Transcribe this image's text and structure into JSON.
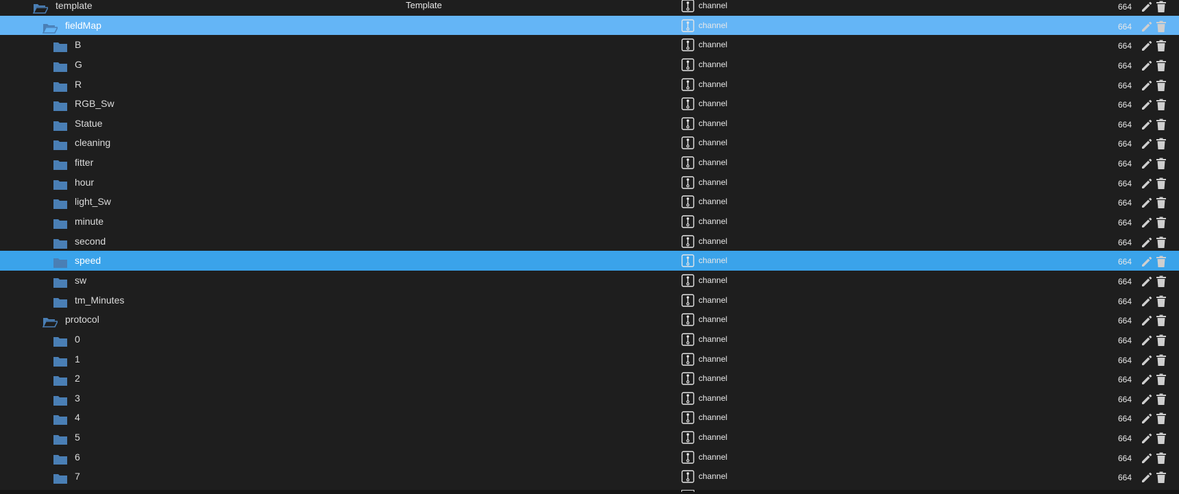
{
  "colors": {
    "background": "#1e1e1e",
    "selected_light": "#64b5f6",
    "selected_strong": "#3aa3ea",
    "folder_icon": "#4a7fb5",
    "text": "#dcdcdc"
  },
  "rows": [
    {
      "name": "template",
      "description": "Template",
      "type": "channel",
      "permission": "664",
      "level": 0,
      "open": true,
      "state": "normal"
    },
    {
      "name": "fieldMap",
      "description": "",
      "type": "channel",
      "permission": "664",
      "level": 1,
      "open": true,
      "state": "selected-light"
    },
    {
      "name": "B",
      "description": "",
      "type": "channel",
      "permission": "664",
      "level": 2,
      "open": false,
      "state": "normal"
    },
    {
      "name": "G",
      "description": "",
      "type": "channel",
      "permission": "664",
      "level": 2,
      "open": false,
      "state": "normal"
    },
    {
      "name": "R",
      "description": "",
      "type": "channel",
      "permission": "664",
      "level": 2,
      "open": false,
      "state": "normal"
    },
    {
      "name": "RGB_Sw",
      "description": "",
      "type": "channel",
      "permission": "664",
      "level": 2,
      "open": false,
      "state": "normal"
    },
    {
      "name": "Statue",
      "description": "",
      "type": "channel",
      "permission": "664",
      "level": 2,
      "open": false,
      "state": "normal"
    },
    {
      "name": "cleaning",
      "description": "",
      "type": "channel",
      "permission": "664",
      "level": 2,
      "open": false,
      "state": "normal"
    },
    {
      "name": "fitter",
      "description": "",
      "type": "channel",
      "permission": "664",
      "level": 2,
      "open": false,
      "state": "normal"
    },
    {
      "name": "hour",
      "description": "",
      "type": "channel",
      "permission": "664",
      "level": 2,
      "open": false,
      "state": "normal"
    },
    {
      "name": "light_Sw",
      "description": "",
      "type": "channel",
      "permission": "664",
      "level": 2,
      "open": false,
      "state": "normal"
    },
    {
      "name": "minute",
      "description": "",
      "type": "channel",
      "permission": "664",
      "level": 2,
      "open": false,
      "state": "normal"
    },
    {
      "name": "second",
      "description": "",
      "type": "channel",
      "permission": "664",
      "level": 2,
      "open": false,
      "state": "normal"
    },
    {
      "name": "speed",
      "description": "",
      "type": "channel",
      "permission": "664",
      "level": 2,
      "open": false,
      "state": "selected-strong"
    },
    {
      "name": "sw",
      "description": "",
      "type": "channel",
      "permission": "664",
      "level": 2,
      "open": false,
      "state": "normal"
    },
    {
      "name": "tm_Minutes",
      "description": "",
      "type": "channel",
      "permission": "664",
      "level": 2,
      "open": false,
      "state": "normal"
    },
    {
      "name": "protocol",
      "description": "",
      "type": "channel",
      "permission": "664",
      "level": 1,
      "open": true,
      "state": "normal"
    },
    {
      "name": "0",
      "description": "",
      "type": "channel",
      "permission": "664",
      "level": 2,
      "open": false,
      "state": "normal"
    },
    {
      "name": "1",
      "description": "",
      "type": "channel",
      "permission": "664",
      "level": 2,
      "open": false,
      "state": "normal"
    },
    {
      "name": "2",
      "description": "",
      "type": "channel",
      "permission": "664",
      "level": 2,
      "open": false,
      "state": "normal"
    },
    {
      "name": "3",
      "description": "",
      "type": "channel",
      "permission": "664",
      "level": 2,
      "open": false,
      "state": "normal"
    },
    {
      "name": "4",
      "description": "",
      "type": "channel",
      "permission": "664",
      "level": 2,
      "open": false,
      "state": "normal"
    },
    {
      "name": "5",
      "description": "",
      "type": "channel",
      "permission": "664",
      "level": 2,
      "open": false,
      "state": "normal"
    },
    {
      "name": "6",
      "description": "",
      "type": "channel",
      "permission": "664",
      "level": 2,
      "open": false,
      "state": "normal"
    },
    {
      "name": "7",
      "description": "",
      "type": "channel",
      "permission": "664",
      "level": 2,
      "open": false,
      "state": "normal"
    }
  ],
  "icons": {
    "folder_open": "folder-open-icon",
    "folder_closed": "folder-icon",
    "type": "channel-type-icon",
    "edit": "pencil-icon",
    "delete": "trash-icon"
  }
}
